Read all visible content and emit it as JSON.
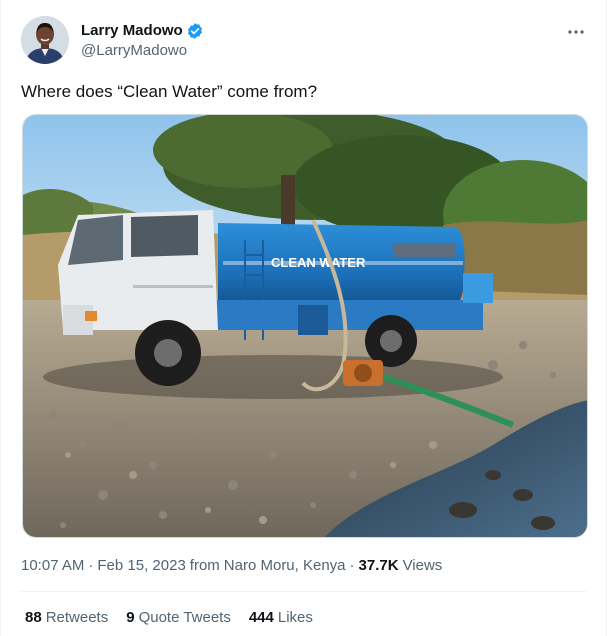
{
  "author": {
    "display_name": "Larry Madowo",
    "handle": "@LarryMadowo",
    "verified": true
  },
  "tweet": {
    "text": "Where does “Clean Water” come from?",
    "time": "10:07 AM",
    "date": "Feb 15, 2023",
    "from_label": "from",
    "location": "Naro Moru, Kenya",
    "views_count": "37.7K",
    "views_label": "Views"
  },
  "media": {
    "truck_text": "CLEAN WATER"
  },
  "stats": {
    "retweets_count": "88",
    "retweets_label": "Retweets",
    "quotes_count": "9",
    "quotes_label": "Quote Tweets",
    "likes_count": "444",
    "likes_label": "Likes"
  },
  "colors": {
    "verified_blue": "#1d9bf0",
    "secondary_text": "#536471",
    "primary_text": "#0f1419"
  },
  "icons": {
    "verified": "verified-badge-icon",
    "more": "more-dots-icon"
  }
}
